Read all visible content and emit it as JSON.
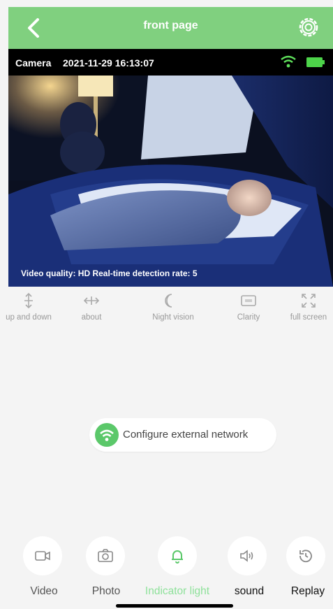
{
  "header": {
    "title": "front page"
  },
  "video": {
    "camera_label": "Camera",
    "timestamp": "2021-11-29 16:13:07",
    "quality_text": "Video quality: HD Real-time detection rate: 5"
  },
  "controls": [
    {
      "label": "up and down"
    },
    {
      "label": "about"
    },
    {
      "label": "Night vision"
    },
    {
      "label": "Clarity"
    },
    {
      "label": "full screen"
    }
  ],
  "network": {
    "label": "Configure external network"
  },
  "bottom_actions": [
    {
      "label": "Video"
    },
    {
      "label": "Photo"
    },
    {
      "label": "Indicator light"
    },
    {
      "label": "sound"
    },
    {
      "label": "Replay"
    }
  ],
  "colors": {
    "header": "#80d07f",
    "accent_green": "#5bc86a",
    "active_label": "#8ee19a"
  }
}
